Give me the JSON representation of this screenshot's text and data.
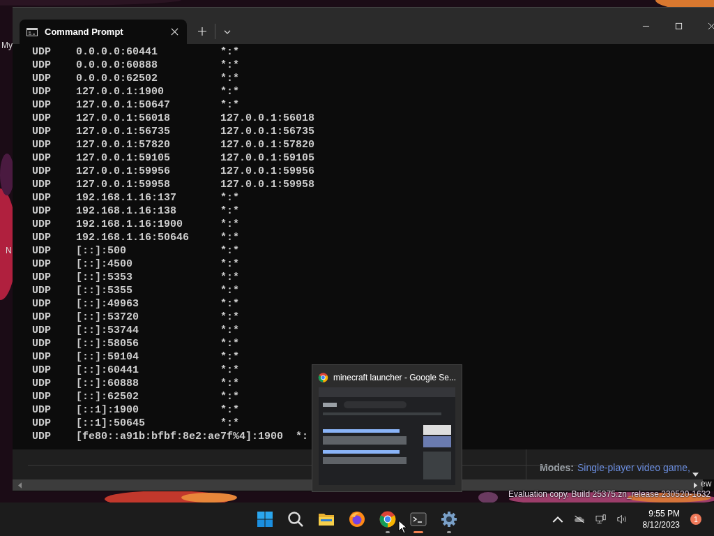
{
  "desktop": {
    "icon_labels": [
      "My",
      "N"
    ],
    "corner_text": "ew",
    "build_text": "Evaluation copy. Build 25375.zn_release.230520-1632"
  },
  "terminal": {
    "tabs": [
      {
        "title": "Command Prompt",
        "selected": true
      }
    ],
    "rows": [
      [
        "UDP",
        "0.0.0.0:60441",
        "*:*"
      ],
      [
        "UDP",
        "0.0.0.0:60888",
        "*:*"
      ],
      [
        "UDP",
        "0.0.0.0:62502",
        "*:*"
      ],
      [
        "UDP",
        "127.0.0.1:1900",
        "*:*"
      ],
      [
        "UDP",
        "127.0.0.1:50647",
        "*:*"
      ],
      [
        "UDP",
        "127.0.0.1:56018",
        "127.0.0.1:56018"
      ],
      [
        "UDP",
        "127.0.0.1:56735",
        "127.0.0.1:56735"
      ],
      [
        "UDP",
        "127.0.0.1:57820",
        "127.0.0.1:57820"
      ],
      [
        "UDP",
        "127.0.0.1:59105",
        "127.0.0.1:59105"
      ],
      [
        "UDP",
        "127.0.0.1:59956",
        "127.0.0.1:59956"
      ],
      [
        "UDP",
        "127.0.0.1:59958",
        "127.0.0.1:59958"
      ],
      [
        "UDP",
        "192.168.1.16:137",
        "*:*"
      ],
      [
        "UDP",
        "192.168.1.16:138",
        "*:*"
      ],
      [
        "UDP",
        "192.168.1.16:1900",
        "*:*"
      ],
      [
        "UDP",
        "192.168.1.16:50646",
        "*:*"
      ],
      [
        "UDP",
        "[::]:500",
        "*:*"
      ],
      [
        "UDP",
        "[::]:4500",
        "*:*"
      ],
      [
        "UDP",
        "[::]:5353",
        "*:*"
      ],
      [
        "UDP",
        "[::]:5355",
        "*:*"
      ],
      [
        "UDP",
        "[::]:49963",
        "*:*"
      ],
      [
        "UDP",
        "[::]:53720",
        "*:*"
      ],
      [
        "UDP",
        "[::]:53744",
        "*:*"
      ],
      [
        "UDP",
        "[::]:58056",
        "*:*"
      ],
      [
        "UDP",
        "[::]:59104",
        "*:*"
      ],
      [
        "UDP",
        "[::]:60441",
        "*:*"
      ],
      [
        "UDP",
        "[::]:60888",
        "*:*"
      ],
      [
        "UDP",
        "[::]:62502",
        "*:*"
      ],
      [
        "UDP",
        "[::1]:1900",
        "*:*"
      ],
      [
        "UDP",
        "[::1]:50645",
        "*:*"
      ],
      [
        "UDP",
        "[fe80::a91b:bfbf:8e2:ae7f%4]:1900",
        "*:"
      ]
    ]
  },
  "browser_behind": {
    "label": "Modes:",
    "link": "Single-player video game,"
  },
  "thumbnail": {
    "title": "minecraft launcher - Google Se...",
    "kind": "picture"
  },
  "taskbar": {
    "items": [
      {
        "kind": "start",
        "running": false,
        "active": false
      },
      {
        "kind": "search",
        "running": false,
        "active": false
      },
      {
        "kind": "folder",
        "running": false,
        "active": false
      },
      {
        "kind": "firefox",
        "running": false,
        "active": false
      },
      {
        "kind": "chrome",
        "running": true,
        "active": false
      },
      {
        "kind": "terminal",
        "running": true,
        "active": true
      },
      {
        "kind": "settings",
        "running": true,
        "active": false
      }
    ],
    "clock": {
      "time": "9:55 PM",
      "date": "8/12/2023"
    },
    "notifications": "1"
  }
}
